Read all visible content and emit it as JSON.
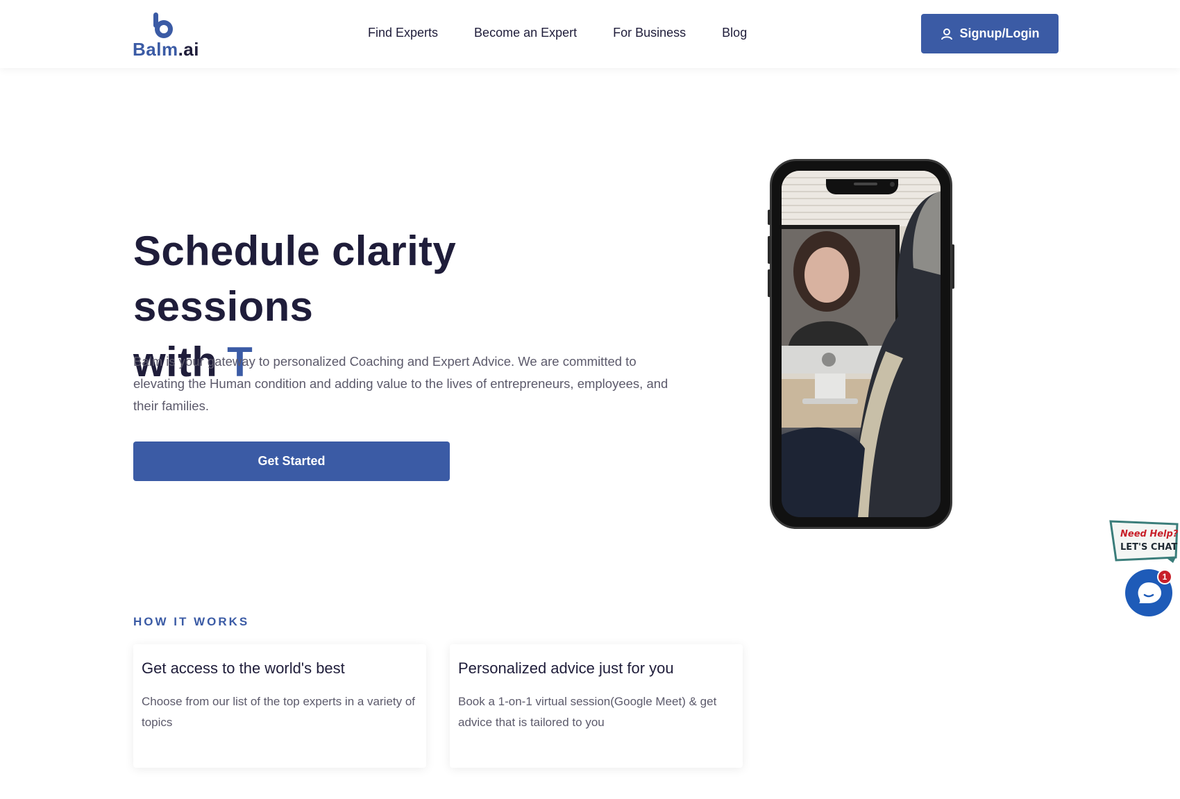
{
  "brand": {
    "name_main": "Balm",
    "name_suffix": ".ai",
    "color": "#3b5ba5"
  },
  "nav": {
    "items": [
      {
        "label": "Find Experts"
      },
      {
        "label": "Become an Expert"
      },
      {
        "label": "For Business"
      },
      {
        "label": "Blog"
      }
    ],
    "signup_label": "Signup/Login",
    "signup_icon": "user-icon"
  },
  "hero": {
    "title_line1": "Schedule clarity sessions",
    "title_line2": "with",
    "typed_text": "T",
    "description": "Balm is your gateway to personalized Coaching and Expert Advice. We are committed to elevating the Human condition and adding value to the lives of entrepreneurs, employees, and their families.",
    "cta_label": "Get Started"
  },
  "how_it_works": {
    "label": "HOW IT WORKS",
    "cards": [
      {
        "title": "Get access to the world's best",
        "text": "Choose from our list of the top experts in a variety of topics"
      },
      {
        "title": "Personalized advice just for you",
        "text": "Book a 1-on-1 virtual session(Google Meet) & get advice that is tailored to you"
      }
    ]
  },
  "chat_widget": {
    "sign_line1": "Need Help?",
    "sign_line2": "LET'S CHAT",
    "badge_count": "1",
    "accent": "#1e5bb8"
  }
}
